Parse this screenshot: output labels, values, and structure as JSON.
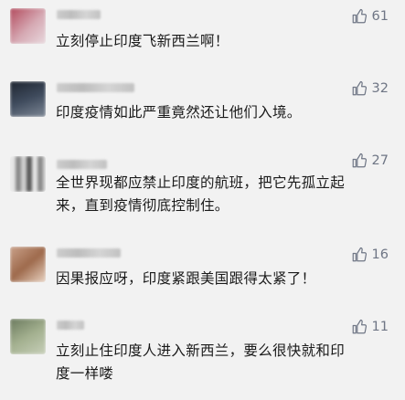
{
  "comments": [
    {
      "text": "立刻停止印度飞新西兰啊！",
      "likes": "61"
    },
    {
      "text": "印度疫情如此严重竟然还让他们入境。",
      "likes": "32"
    },
    {
      "text": "全世界现都应禁止印度的航班，把它先孤立起\n来，直到疫情彻底控制住。",
      "likes": "27"
    },
    {
      "text": "因果报应呀，印度紧跟美国跟得太紧了！",
      "likes": "16"
    },
    {
      "text": "立刻止住印度人进入新西兰，要么很快就和印\n度一样喽",
      "likes": "11"
    }
  ],
  "icons": {
    "like": "thumbs-up-icon"
  },
  "colors": {
    "background": "#f2f2f2",
    "text": "#1a1a1a",
    "like": "#6f7685"
  }
}
